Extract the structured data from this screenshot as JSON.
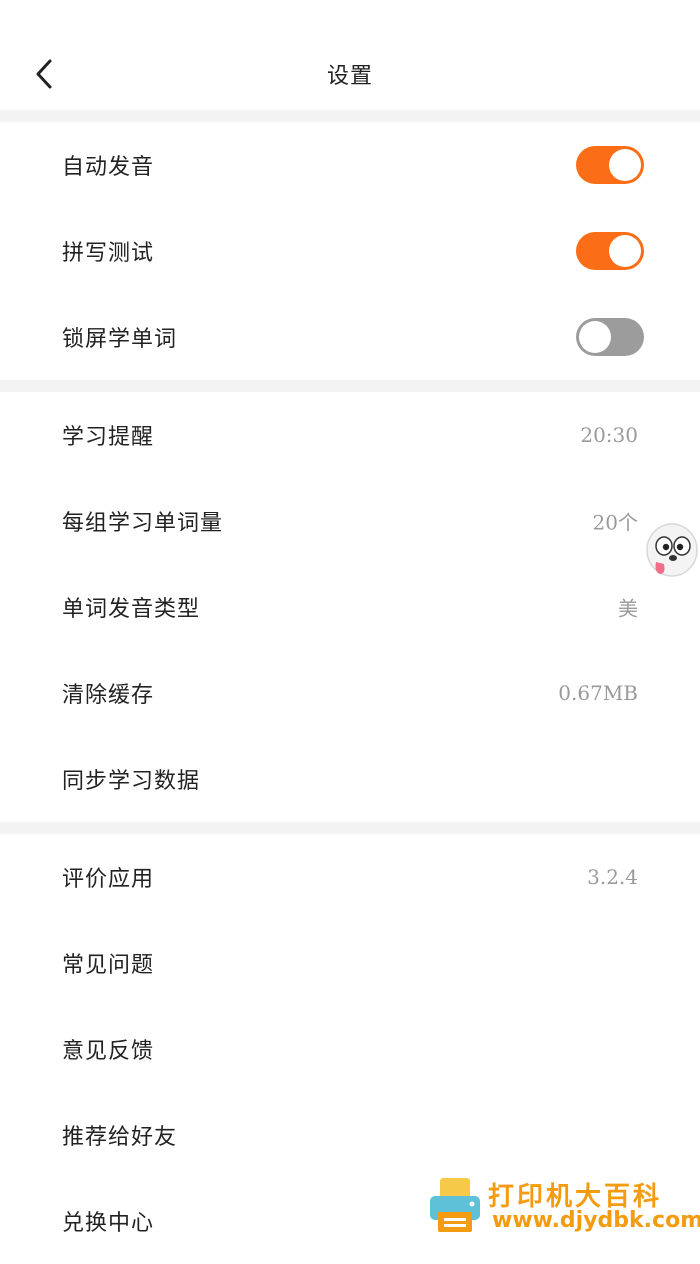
{
  "header": {
    "title": "设置"
  },
  "section1": [
    {
      "label": "自动发音",
      "on": true
    },
    {
      "label": "拼写测试",
      "on": true
    },
    {
      "label": "锁屏学单词",
      "on": false
    }
  ],
  "section2": [
    {
      "label": "学习提醒",
      "value": "20:30"
    },
    {
      "label": "每组学习单词量",
      "value": "20个"
    },
    {
      "label": "单词发音类型",
      "value": "美"
    },
    {
      "label": "清除缓存",
      "value": "0.67MB"
    },
    {
      "label": "同步学习数据",
      "value": ""
    }
  ],
  "section3": [
    {
      "label": "评价应用",
      "value": "3.2.4"
    },
    {
      "label": "常见问题",
      "value": ""
    },
    {
      "label": "意见反馈",
      "value": ""
    },
    {
      "label": "推荐给好友",
      "value": ""
    },
    {
      "label": "兑换中心",
      "value": ""
    }
  ],
  "watermark": {
    "text": "打印机大百科",
    "url": "www.djydbk.com"
  },
  "colors": {
    "accent": "#fb6e17",
    "toggle_off": "#9c9c9c",
    "divider": "#f3f3f3"
  }
}
